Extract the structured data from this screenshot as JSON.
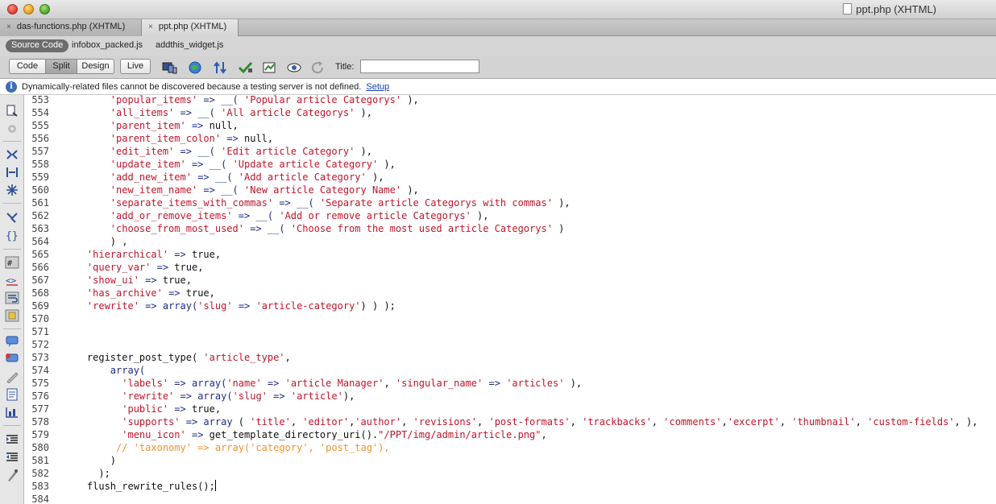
{
  "window": {
    "title": "ppt.php (XHTML)"
  },
  "tabs": [
    {
      "label": "das-functions.php (XHTML)",
      "close": "×"
    },
    {
      "label": "ppt.php (XHTML)",
      "close": "×"
    }
  ],
  "related_files": {
    "source_code": "Source Code",
    "files": [
      "infobox_packed.js",
      "addthis_widget.js"
    ]
  },
  "toolbar": {
    "view_buttons": [
      "Code",
      "Split",
      "Design"
    ],
    "selected_view": "Split",
    "live_button": "Live",
    "title_label": "Title:",
    "title_value": "",
    "icons": [
      "multiscreen-icon",
      "browser-preview-icon",
      "file-management-icon",
      "check-page-icon",
      "visual-aids-icon",
      "live-view-options-icon",
      "refresh-icon"
    ]
  },
  "infobar": {
    "message": "Dynamically-related files cannot be discovered because a testing server is not defined.",
    "link": "Setup"
  },
  "editor": {
    "lines": [
      {
        "num": "553",
        "parts": [
          [
            "n",
            "        "
          ],
          [
            "s",
            "'popular_items'"
          ],
          [
            "n",
            " "
          ],
          [
            "k",
            "=>"
          ],
          [
            "n",
            " "
          ],
          [
            "k",
            "__("
          ],
          [
            "n",
            " "
          ],
          [
            "s",
            "'Popular article Categorys'"
          ],
          [
            "n",
            " ),"
          ]
        ]
      },
      {
        "num": "554",
        "parts": [
          [
            "n",
            "        "
          ],
          [
            "s",
            "'all_items'"
          ],
          [
            "n",
            " "
          ],
          [
            "k",
            "=>"
          ],
          [
            "n",
            " "
          ],
          [
            "k",
            "__("
          ],
          [
            "n",
            " "
          ],
          [
            "s",
            "'All article Categorys'"
          ],
          [
            "n",
            " ),"
          ]
        ]
      },
      {
        "num": "555",
        "parts": [
          [
            "n",
            "        "
          ],
          [
            "s",
            "'parent_item'"
          ],
          [
            "n",
            " "
          ],
          [
            "k",
            "=>"
          ],
          [
            "n",
            " null,"
          ]
        ]
      },
      {
        "num": "556",
        "parts": [
          [
            "n",
            "        "
          ],
          [
            "s",
            "'parent_item_colon'"
          ],
          [
            "n",
            " "
          ],
          [
            "k",
            "=>"
          ],
          [
            "n",
            " null,"
          ]
        ]
      },
      {
        "num": "557",
        "parts": [
          [
            "n",
            "        "
          ],
          [
            "s",
            "'edit_item'"
          ],
          [
            "n",
            " "
          ],
          [
            "k",
            "=>"
          ],
          [
            "n",
            " "
          ],
          [
            "k",
            "__("
          ],
          [
            "n",
            " "
          ],
          [
            "s",
            "'Edit article Category'"
          ],
          [
            "n",
            " ),"
          ]
        ]
      },
      {
        "num": "558",
        "parts": [
          [
            "n",
            "        "
          ],
          [
            "s",
            "'update_item'"
          ],
          [
            "n",
            " "
          ],
          [
            "k",
            "=>"
          ],
          [
            "n",
            " "
          ],
          [
            "k",
            "__("
          ],
          [
            "n",
            " "
          ],
          [
            "s",
            "'Update article Category'"
          ],
          [
            "n",
            " ),"
          ]
        ]
      },
      {
        "num": "559",
        "parts": [
          [
            "n",
            "        "
          ],
          [
            "s",
            "'add_new_item'"
          ],
          [
            "n",
            " "
          ],
          [
            "k",
            "=>"
          ],
          [
            "n",
            " "
          ],
          [
            "k",
            "__("
          ],
          [
            "n",
            " "
          ],
          [
            "s",
            "'Add article Category'"
          ],
          [
            "n",
            " ),"
          ]
        ]
      },
      {
        "num": "560",
        "parts": [
          [
            "n",
            "        "
          ],
          [
            "s",
            "'new_item_name'"
          ],
          [
            "n",
            " "
          ],
          [
            "k",
            "=>"
          ],
          [
            "n",
            " "
          ],
          [
            "k",
            "__("
          ],
          [
            "n",
            " "
          ],
          [
            "s",
            "'New article Category Name'"
          ],
          [
            "n",
            " ),"
          ]
        ]
      },
      {
        "num": "561",
        "parts": [
          [
            "n",
            "        "
          ],
          [
            "s",
            "'separate_items_with_commas'"
          ],
          [
            "n",
            " "
          ],
          [
            "k",
            "=>"
          ],
          [
            "n",
            " "
          ],
          [
            "k",
            "__("
          ],
          [
            "n",
            " "
          ],
          [
            "s",
            "'Separate article Categorys with commas'"
          ],
          [
            "n",
            " ),"
          ]
        ]
      },
      {
        "num": "562",
        "parts": [
          [
            "n",
            "        "
          ],
          [
            "s",
            "'add_or_remove_items'"
          ],
          [
            "n",
            " "
          ],
          [
            "k",
            "=>"
          ],
          [
            "n",
            " "
          ],
          [
            "k",
            "__("
          ],
          [
            "n",
            " "
          ],
          [
            "s",
            "'Add or remove article Categorys'"
          ],
          [
            "n",
            " ),"
          ]
        ]
      },
      {
        "num": "563",
        "parts": [
          [
            "n",
            "        "
          ],
          [
            "s",
            "'choose_from_most_used'"
          ],
          [
            "n",
            " "
          ],
          [
            "k",
            "=>"
          ],
          [
            "n",
            " "
          ],
          [
            "k",
            "__("
          ],
          [
            "n",
            " "
          ],
          [
            "s",
            "'Choose from the most used article Categorys'"
          ],
          [
            "n",
            " )"
          ]
        ]
      },
      {
        "num": "564",
        "parts": [
          [
            "n",
            "        ) ,"
          ]
        ]
      },
      {
        "num": "565",
        "parts": [
          [
            "n",
            "    "
          ],
          [
            "s",
            "'hierarchical'"
          ],
          [
            "n",
            " "
          ],
          [
            "k",
            "=>"
          ],
          [
            "n",
            " true,"
          ]
        ]
      },
      {
        "num": "566",
        "parts": [
          [
            "n",
            "    "
          ],
          [
            "s",
            "'query_var'"
          ],
          [
            "n",
            " "
          ],
          [
            "k",
            "=>"
          ],
          [
            "n",
            " true,"
          ]
        ]
      },
      {
        "num": "567",
        "parts": [
          [
            "n",
            "    "
          ],
          [
            "s",
            "'show_ui'"
          ],
          [
            "n",
            " "
          ],
          [
            "k",
            "=>"
          ],
          [
            "n",
            " true,"
          ]
        ]
      },
      {
        "num": "568",
        "parts": [
          [
            "n",
            "    "
          ],
          [
            "s",
            "'has_archive'"
          ],
          [
            "n",
            " "
          ],
          [
            "k",
            "=>"
          ],
          [
            "n",
            " true,"
          ]
        ]
      },
      {
        "num": "569",
        "parts": [
          [
            "n",
            "    "
          ],
          [
            "s",
            "'rewrite'"
          ],
          [
            "n",
            " "
          ],
          [
            "k",
            "=>"
          ],
          [
            "n",
            " "
          ],
          [
            "k",
            "array("
          ],
          [
            "s",
            "'slug'"
          ],
          [
            "n",
            " "
          ],
          [
            "k",
            "=>"
          ],
          [
            "n",
            " "
          ],
          [
            "s",
            "'article-category'"
          ],
          [
            "n",
            ") ) );"
          ]
        ]
      },
      {
        "num": "570",
        "parts": []
      },
      {
        "num": "571",
        "parts": []
      },
      {
        "num": "572",
        "parts": []
      },
      {
        "num": "573",
        "parts": [
          [
            "n",
            "    register_post_type( "
          ],
          [
            "s",
            "'article_type'"
          ],
          [
            "n",
            ","
          ]
        ]
      },
      {
        "num": "574",
        "parts": [
          [
            "n",
            "        "
          ],
          [
            "k",
            "array("
          ]
        ]
      },
      {
        "num": "575",
        "parts": [
          [
            "n",
            "          "
          ],
          [
            "s",
            "'labels'"
          ],
          [
            "n",
            " "
          ],
          [
            "k",
            "=>"
          ],
          [
            "n",
            " "
          ],
          [
            "k",
            "array("
          ],
          [
            "s",
            "'name'"
          ],
          [
            "n",
            " "
          ],
          [
            "k",
            "=>"
          ],
          [
            "n",
            " "
          ],
          [
            "s",
            "'article Manager'"
          ],
          [
            "n",
            ", "
          ],
          [
            "s",
            "'singular_name'"
          ],
          [
            "n",
            " "
          ],
          [
            "k",
            "=>"
          ],
          [
            "n",
            " "
          ],
          [
            "s",
            "'articles'"
          ],
          [
            "n",
            " ),"
          ]
        ]
      },
      {
        "num": "576",
        "parts": [
          [
            "n",
            "          "
          ],
          [
            "s",
            "'rewrite'"
          ],
          [
            "n",
            " "
          ],
          [
            "k",
            "=>"
          ],
          [
            "n",
            " "
          ],
          [
            "k",
            "array("
          ],
          [
            "s",
            "'slug'"
          ],
          [
            "n",
            " "
          ],
          [
            "k",
            "=>"
          ],
          [
            "n",
            " "
          ],
          [
            "s",
            "'article'"
          ],
          [
            "n",
            "),"
          ]
        ]
      },
      {
        "num": "577",
        "parts": [
          [
            "n",
            "          "
          ],
          [
            "s",
            "'public'"
          ],
          [
            "n",
            " "
          ],
          [
            "k",
            "=>"
          ],
          [
            "n",
            " true,"
          ]
        ]
      },
      {
        "num": "578",
        "parts": [
          [
            "n",
            "          "
          ],
          [
            "s",
            "'supports'"
          ],
          [
            "n",
            " "
          ],
          [
            "k",
            "=>"
          ],
          [
            "n",
            " "
          ],
          [
            "k",
            "array"
          ],
          [
            "n",
            " ( "
          ],
          [
            "s",
            "'title'"
          ],
          [
            "n",
            ", "
          ],
          [
            "s",
            "'editor'"
          ],
          [
            "n",
            ","
          ],
          [
            "s",
            "'author'"
          ],
          [
            "n",
            ", "
          ],
          [
            "s",
            "'revisions'"
          ],
          [
            "n",
            ", "
          ],
          [
            "s",
            "'post-formats'"
          ],
          [
            "n",
            ", "
          ],
          [
            "s",
            "'trackbacks'"
          ],
          [
            "n",
            ", "
          ],
          [
            "s",
            "'comments'"
          ],
          [
            "n",
            ","
          ],
          [
            "s",
            "'excerpt'"
          ],
          [
            "n",
            ", "
          ],
          [
            "s",
            "'thumbnail'"
          ],
          [
            "n",
            ", "
          ],
          [
            "s",
            "'custom-fields'"
          ],
          [
            "n",
            ", ),"
          ]
        ]
      },
      {
        "num": "579",
        "parts": [
          [
            "n",
            "          "
          ],
          [
            "s",
            "'menu_icon'"
          ],
          [
            "n",
            " "
          ],
          [
            "k",
            "=>"
          ],
          [
            "n",
            " get_template_directory_uri()."
          ],
          [
            "s",
            "\"/PPT/img/admin/article.png\""
          ],
          [
            "n",
            ","
          ]
        ]
      },
      {
        "num": "580",
        "parts": [
          [
            "n",
            "         "
          ],
          [
            "c",
            "// 'taxonomy' => array('category', 'post_tag'),"
          ]
        ]
      },
      {
        "num": "581",
        "parts": [
          [
            "n",
            "        )"
          ]
        ]
      },
      {
        "num": "582",
        "parts": [
          [
            "n",
            "      );"
          ]
        ]
      },
      {
        "num": "583",
        "parts": [
          [
            "n",
            "    flush_rewrite_rules();"
          ]
        ],
        "caret": true
      },
      {
        "num": "584",
        "parts": []
      }
    ]
  },
  "colors": {
    "string": "#c0152a",
    "keyword": "#1d2a8a",
    "comment": "#f2912f"
  }
}
